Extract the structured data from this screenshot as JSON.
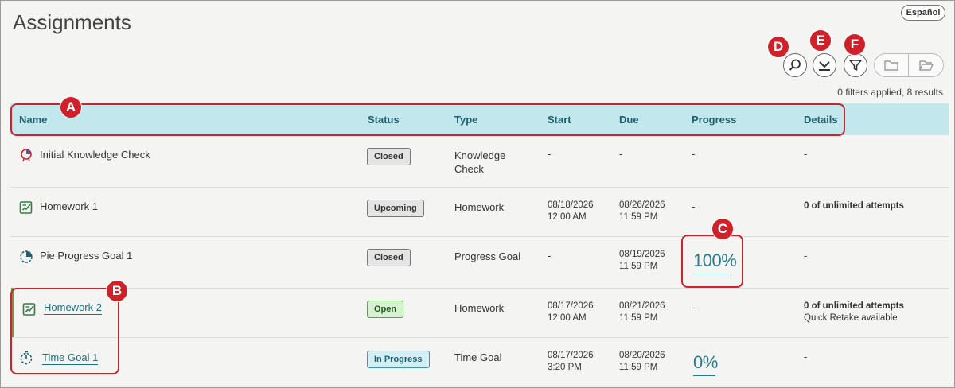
{
  "page": {
    "title": "Assignments",
    "language_button": "Español"
  },
  "toolbar": {
    "results_text": "0 filters applied, 8 results"
  },
  "table": {
    "headers": [
      "Name",
      "Status",
      "Type",
      "Start",
      "Due",
      "Progress",
      "Details"
    ],
    "rows": [
      {
        "name": "Initial Knowledge Check",
        "status": "Closed",
        "type": "Knowledge Check",
        "start": "-",
        "due": "-",
        "progress": "-",
        "details": "-"
      },
      {
        "name": "Homework 1",
        "status": "Upcoming",
        "type": "Homework",
        "start_date": "08/18/2026",
        "start_time": "12:00 AM",
        "due_date": "08/26/2026",
        "due_time": "11:59 PM",
        "progress": "-",
        "details": "0 of unlimited attempts"
      },
      {
        "name": "Pie Progress Goal 1",
        "status": "Closed",
        "type": "Progress Goal",
        "start": "-",
        "due_date": "08/19/2026",
        "due_time": "11:59 PM",
        "progress": "100%",
        "details": "-"
      },
      {
        "name": "Homework 2",
        "status": "Open",
        "type": "Homework",
        "start_date": "08/17/2026",
        "start_time": "12:00 AM",
        "due_date": "08/21/2026",
        "due_time": "11:59 PM",
        "progress": "-",
        "details": "0 of unlimited attempts",
        "details_sub": "Quick Retake available"
      },
      {
        "name": "Time Goal 1",
        "status": "In Progress",
        "type": "Time Goal",
        "start_date": "08/17/2026",
        "start_time": "3:20 PM",
        "due_date": "08/20/2026",
        "due_time": "11:59 PM",
        "progress": "0%",
        "details": "-"
      }
    ]
  },
  "markers": [
    "A",
    "B",
    "C",
    "D",
    "E",
    "F"
  ],
  "icons": {
    "search": "search-icon",
    "download": "download-icon",
    "filter": "filter-icon",
    "folder": "folder-icon",
    "folder_open": "folder-open-icon"
  },
  "colors": {
    "header_bg": "#c2e8ee",
    "marker_red": "#d0202a",
    "link": "#1d6f80",
    "open_green": "#58a34b"
  }
}
